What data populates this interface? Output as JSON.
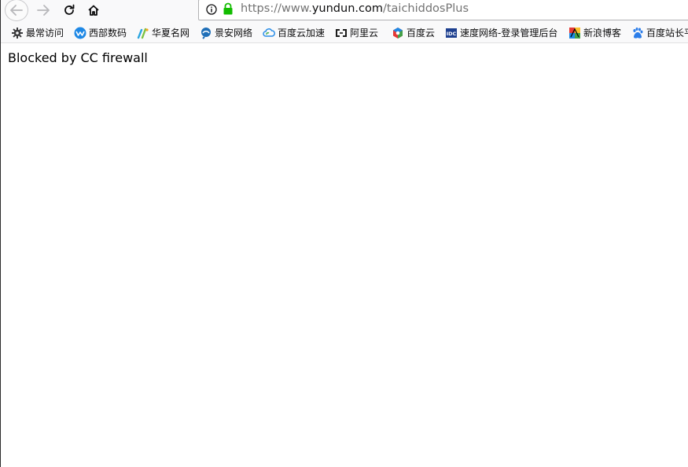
{
  "toolbar": {
    "url_prefix": "https://www.",
    "url_domain": "yundun.com",
    "url_path": "/taichiddosPlus"
  },
  "bookmarks": [
    {
      "label": "最常访问",
      "icon": "gear-icon"
    },
    {
      "label": "西部数码",
      "icon": "west-digital-icon"
    },
    {
      "label": "华夏名网",
      "icon": "huaxia-icon"
    },
    {
      "label": "景安网络",
      "icon": "jingan-icon"
    },
    {
      "label": "百度云加速",
      "icon": "cloud-icon"
    },
    {
      "label": "阿里云",
      "icon": "aliyun-icon"
    },
    {
      "label": "百度云",
      "icon": "baidu-cloud-icon"
    },
    {
      "label": "速度网络-登录管理后台",
      "icon": "idc-icon"
    },
    {
      "label": "新浪博客",
      "icon": "sina-icon"
    },
    {
      "label": "百度站长平",
      "icon": "baidu-paw-icon"
    }
  ],
  "page": {
    "message": "Blocked by CC firewall"
  }
}
